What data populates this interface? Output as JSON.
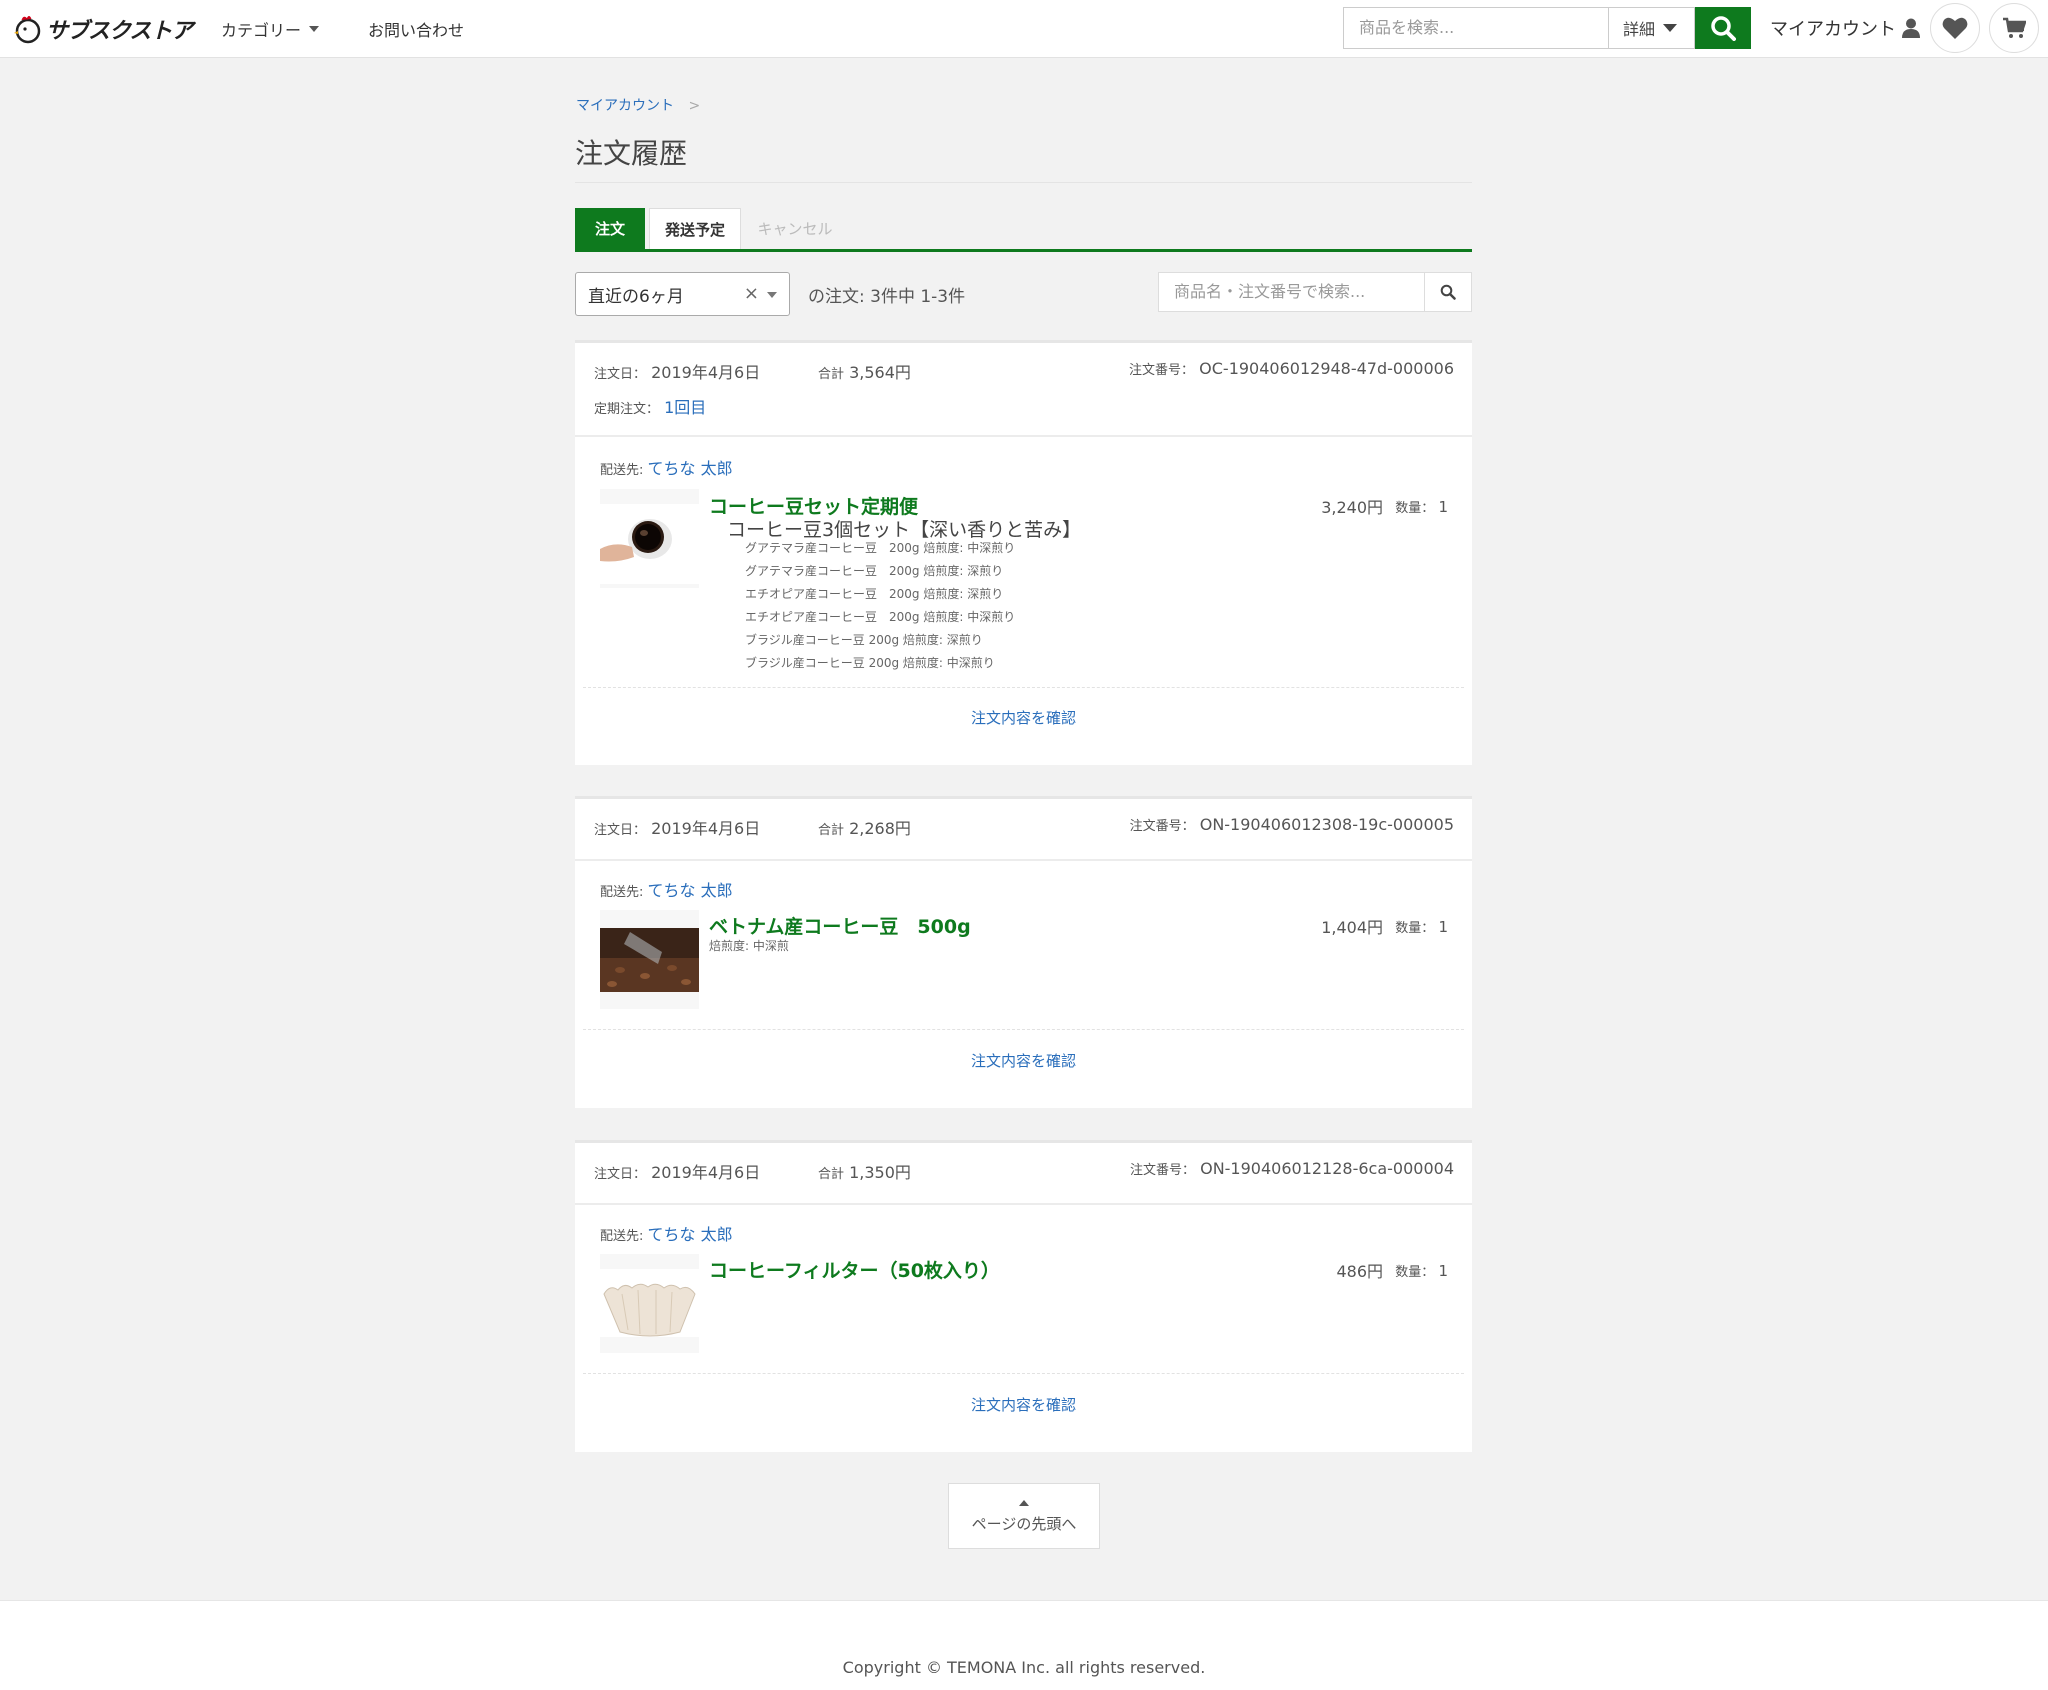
{
  "header": {
    "logo": "サブスクストア",
    "nav": {
      "category": "カテゴリー",
      "contact": "お問い合わせ"
    },
    "search_placeholder": "商品を検索...",
    "detail": "詳細",
    "account": "マイアカウント"
  },
  "breadcrumb": {
    "parent": "マイアカウント",
    "sep": ">"
  },
  "page_title": "注文履歴",
  "tabs": [
    "注文",
    "発送予定",
    "キャンセル"
  ],
  "filter": {
    "selected": "直近の6ヶ月",
    "clear": "×",
    "count_text": "の注文: 3件中 1-3件",
    "search_placeholder": "商品名・注文番号で検索..."
  },
  "labels": {
    "order_date": "注文日：",
    "total": "合計",
    "order_no": "注文番号：",
    "subscription": "定期注文：",
    "ship_to": "配送先:",
    "qty": "数量：",
    "confirm": "注文内容を確認"
  },
  "orders": [
    {
      "date": "2019年4月6日",
      "total": "3,564円",
      "number": "OC-190406012948-47d-000006",
      "subscription": "1回目",
      "ship_to": "てちな 太郎",
      "product": {
        "name": "コーヒー豆セット定期便",
        "sub": "コーヒー豆3個セット【深い香りと苦み】",
        "options": [
          "グアテマラ産コーヒー豆　200g 焙煎度: 中深煎り",
          "グアテマラ産コーヒー豆　200g 焙煎度: 深煎り",
          "エチオピア産コーヒー豆　200g 焙煎度: 深煎り",
          "エチオピア産コーヒー豆　200g 焙煎度: 中深煎り",
          "ブラジル産コーヒー豆 200g 焙煎度: 深煎り",
          "ブラジル産コーヒー豆 200g 焙煎度: 中深煎り"
        ],
        "price": "3,240円",
        "qty": "1"
      }
    },
    {
      "date": "2019年4月6日",
      "total": "2,268円",
      "number": "ON-190406012308-19c-000005",
      "ship_to": "てちな 太郎",
      "product": {
        "name": "ベトナム産コーヒー豆　500g",
        "option": "焙煎度: 中深煎",
        "price": "1,404円",
        "qty": "1"
      }
    },
    {
      "date": "2019年4月6日",
      "total": "1,350円",
      "number": "ON-190406012128-6ca-000004",
      "ship_to": "てちな 太郎",
      "product": {
        "name": "コーヒーフィルター（50枚入り）",
        "price": "486円",
        "qty": "1"
      }
    }
  ],
  "to_top": "ページの先頭へ",
  "footer": {
    "copyright": "Copyright © TEMONA Inc. all rights reserved."
  },
  "colors": {
    "brand_green": "#0e7a1e",
    "link_blue": "#2a6ebb",
    "background": "#f2f2f2"
  }
}
